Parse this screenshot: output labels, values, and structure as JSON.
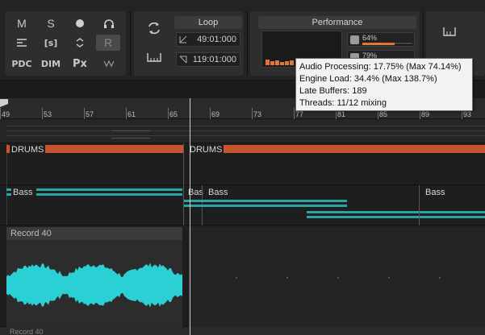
{
  "toolbar": {
    "buttons": {
      "mute": "M",
      "solo": "S",
      "stereo": "[s]",
      "record": "R",
      "pdc": "PDC",
      "dim": "DIM",
      "px": "Px"
    },
    "icons": [
      "record-dot-icon",
      "headphones-icon",
      "fx-icon",
      "swap-icon",
      "wave-icon",
      "loop-cycle-icon",
      "punch-icon"
    ]
  },
  "loop": {
    "title": "Loop",
    "start": "49:01:000",
    "end": "119:01:000"
  },
  "performance": {
    "title": "Performance",
    "meter1_pct": "64%",
    "meter1_value": 0.64,
    "meter2_pct": "79%",
    "meter2_value": 0.79,
    "graph_bars": [
      0.15,
      0.12,
      0.14,
      0.1,
      0.12,
      0.13
    ]
  },
  "tooltip": {
    "line1": "Audio Processing:  17.75% (Max 74.14%)",
    "line2": "Engine Load:  34.4% (Max 138.7%)",
    "line3": "Late Buffers:  189",
    "line4": "Threads:  11/12 mixing"
  },
  "ruler": {
    "labels": [
      "49",
      "53",
      "57",
      "61",
      "65",
      "69",
      "73",
      "77",
      "81",
      "85",
      "89",
      "93"
    ]
  },
  "tracks": {
    "drums1": "DRUMS",
    "drums2": "DRUMS",
    "bass1": "Bass",
    "bass2": "Bas",
    "bass3": "Bass",
    "bass4": "Bass",
    "record_name": "Record 40",
    "record_next": "Record 40"
  },
  "colors": {
    "accent_orange": "#e2763a",
    "clip_orange": "#c4552f",
    "teal": "#2aa4a4",
    "wave": "#2ad0d4"
  }
}
